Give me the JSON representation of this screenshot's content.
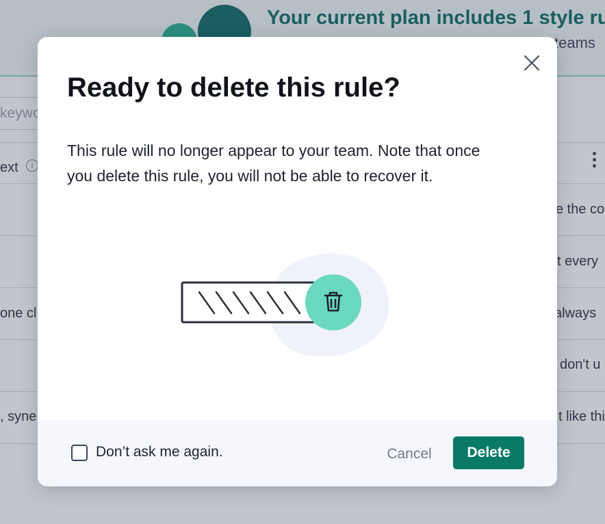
{
  "background": {
    "banner_title": "Your current plan includes 1 style ru",
    "banner_subtitle": "teams",
    "search_placeholder": "keywo",
    "table_header_left": "ext",
    "info_icon_glyph": "i",
    "rows_left": [
      "",
      "",
      "one cl",
      "",
      ", syne"
    ],
    "rows_right": [
      "e the co",
      "t every",
      "always",
      "don't u",
      "t like thi"
    ]
  },
  "modal": {
    "title": "Ready to delete this rule?",
    "body": "This rule will no longer appear to your team. Note that once you delete this rule, you will not be able to recover it.",
    "close_icon": "close-icon",
    "illustration_icon": "trash-icon",
    "checkbox_label": "Don’t ask me again.",
    "checkbox_checked": false,
    "cancel_label": "Cancel",
    "delete_label": "Delete"
  },
  "colors": {
    "brand_dark": "#0a7a68",
    "accent_mint": "#6ad9c0",
    "banner_text": "#0d6e62"
  }
}
